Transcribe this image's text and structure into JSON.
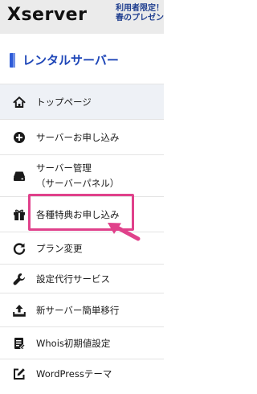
{
  "header": {
    "logo_text": "Xserver",
    "promo_line1": "利用者限定！",
    "promo_line2": "春のプレゼン"
  },
  "sidebar": {
    "section_title": "レンタルサーバー",
    "items": [
      {
        "label": "トップページ",
        "icon": "home-icon",
        "active": true
      },
      {
        "label": "サーバーお申し込み",
        "icon": "plus-circle-icon"
      },
      {
        "label_line1": "サーバー管理",
        "label_line2": "（サーバーパネル）",
        "icon": "server-drive-icon"
      },
      {
        "label": "各種特典お申し込み",
        "icon": "gift-icon"
      },
      {
        "label": "プラン変更",
        "icon": "refresh-icon"
      },
      {
        "label": "設定代行サービス",
        "icon": "wrench-icon"
      },
      {
        "label": "新サーバー簡単移行",
        "icon": "upload-tray-icon"
      },
      {
        "label": "Whois初期値設定",
        "icon": "document-icon"
      },
      {
        "label": "WordPressテーマ",
        "icon": "edit-square-icon"
      }
    ]
  },
  "colors": {
    "accent_blue": "#1f47b8",
    "highlight_pink": "#e0418b",
    "active_bg": "#eef1f6"
  }
}
